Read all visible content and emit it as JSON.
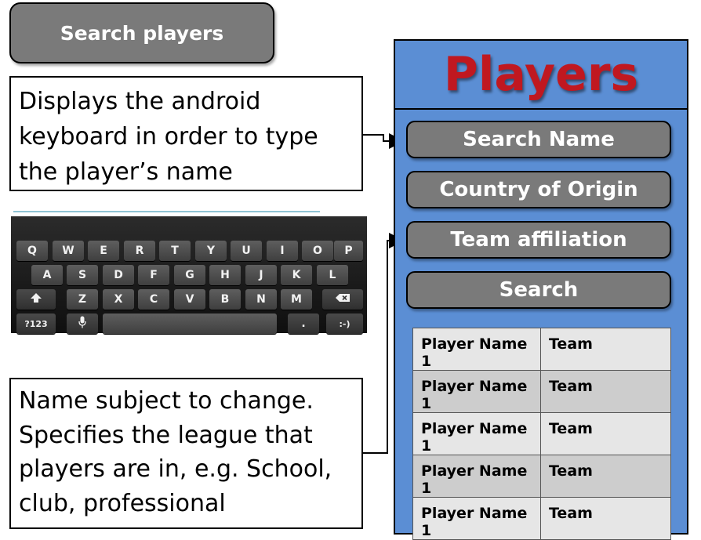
{
  "header": {
    "title": "Search players"
  },
  "callouts": {
    "keyboard": "Displays the android\nkeyboard in order to type\nthe player’s name",
    "league": "Name subject to change.\nSpecifies the  league that\nplayers are in, e.g. School,\nclub, professional"
  },
  "keyboard": {
    "row1": [
      "Q",
      "W",
      "E",
      "R",
      "T",
      "Y",
      "U",
      "I",
      "O",
      "P"
    ],
    "row2": [
      "A",
      "S",
      "D",
      "F",
      "G",
      "H",
      "J",
      "K",
      "L"
    ],
    "row3": [
      "Z",
      "X",
      "C",
      "V",
      "B",
      "N",
      "M"
    ],
    "shift_icon": "shift-arrow-icon",
    "backspace_icon": "backspace-icon",
    "symbols_label": "?123",
    "mic_icon": "microphone-icon",
    "period_label": ".",
    "smiley_label": ":-)"
  },
  "phone": {
    "title": "Players",
    "buttons": {
      "search_name": "Search Name",
      "country": "Country of Origin",
      "team": "Team affiliation",
      "search": "Search"
    },
    "results": [
      {
        "name": "Player Name 1",
        "team": "Team"
      },
      {
        "name": "Player Name 1",
        "team": "Team"
      },
      {
        "name": "Player Name 1",
        "team": "Team"
      },
      {
        "name": "Player Name 1",
        "team": "Team"
      },
      {
        "name": "Player Name 1",
        "team": "Team"
      }
    ]
  },
  "colors": {
    "panel": "#5b8ed4",
    "title_red": "#c01820",
    "button_gray": "#7a7a7a"
  }
}
